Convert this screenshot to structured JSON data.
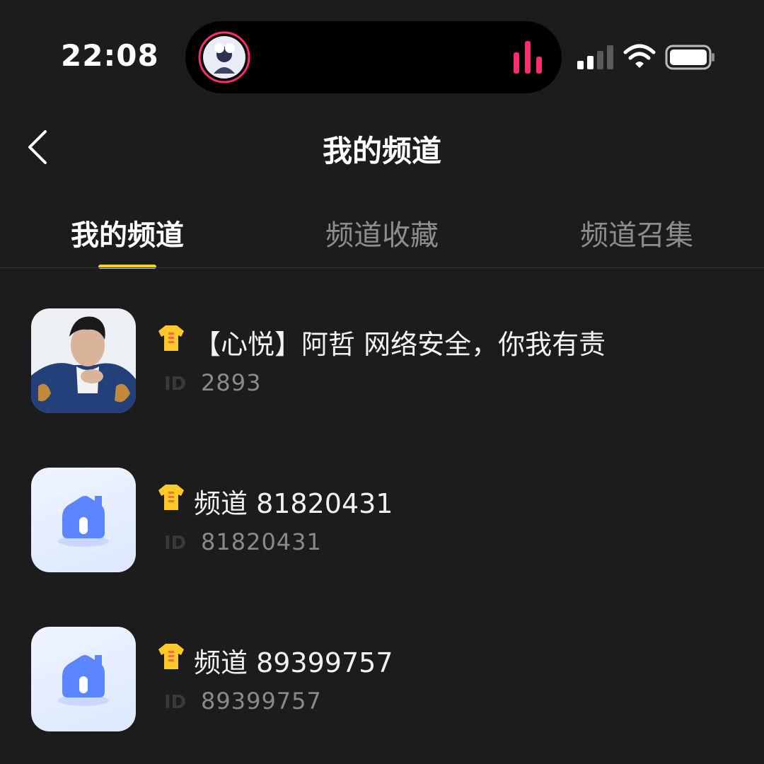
{
  "status_bar": {
    "time": "22:08",
    "accent_color": "#ff2d6f"
  },
  "header": {
    "title": "我的频道",
    "back_icon": "chevron-left-icon"
  },
  "tabs": [
    {
      "label": "我的频道",
      "active": true
    },
    {
      "label": "频道收藏",
      "active": false
    },
    {
      "label": "频道召集",
      "active": false
    }
  ],
  "accent_color": "#ffd21e",
  "channels": [
    {
      "name": "【心悦】阿哲  网络安全，你我有责",
      "id_label": "ID",
      "id": "2893",
      "avatar": "person-photo"
    },
    {
      "name": "频道 81820431",
      "id_label": "ID",
      "id": "81820431",
      "avatar": "home-icon"
    },
    {
      "name": "频道 89399757",
      "id_label": "ID",
      "id": "89399757",
      "avatar": "home-icon"
    }
  ]
}
